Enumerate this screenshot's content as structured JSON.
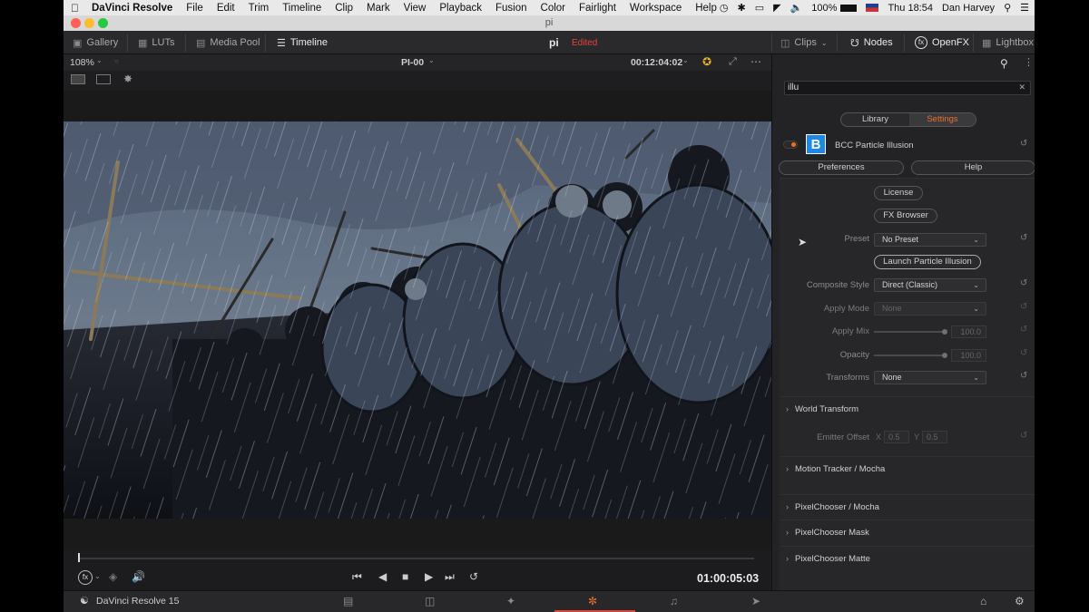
{
  "menubar": {
    "app_name": "DaVinci Resolve",
    "items": [
      "File",
      "Edit",
      "Trim",
      "Timeline",
      "Clip",
      "Mark",
      "View",
      "Playback",
      "Fusion",
      "Color",
      "Fairlight",
      "Workspace",
      "Help"
    ],
    "battery": "100%",
    "clock": "Thu 18:54",
    "user": "Dan Harvey"
  },
  "window": {
    "title": "pi"
  },
  "toolbar": {
    "gallery": "Gallery",
    "luts": "LUTs",
    "media_pool": "Media Pool",
    "timeline": "Timeline",
    "project_name": "pi",
    "project_status": "Edited",
    "clips": "Clips",
    "nodes": "Nodes",
    "openfx": "OpenFX",
    "lightbox": "Lightbox"
  },
  "viewer": {
    "zoom": "108%",
    "clip_name": "PI-00",
    "source_timecode": "00:12:04:02",
    "record_timecode": "01:00:05:03"
  },
  "openfx_panel": {
    "search_value": "illu",
    "tabs": {
      "library": "Library",
      "settings": "Settings"
    },
    "plugin_name": "BCC Particle Illusion",
    "plugin_badge": "B",
    "preferences": "Preferences",
    "help": "Help",
    "license": "License",
    "fx_browser": "FX Browser",
    "preset_label": "Preset",
    "preset_value": "No Preset",
    "launch": "Launch Particle Illusion",
    "composite_label": "Composite Style",
    "composite_value": "Direct (Classic)",
    "apply_mode_label": "Apply Mode",
    "apply_mode_value": "None",
    "apply_mix_label": "Apply Mix",
    "apply_mix_value": "100.0",
    "opacity_label": "Opacity",
    "opacity_value": "100.0",
    "transforms_label": "Transforms",
    "transforms_value": "None",
    "emitter_label": "Emitter Offset",
    "emitter_x_label": "X",
    "emitter_x": "0.5",
    "emitter_y_label": "Y",
    "emitter_y": "0.5",
    "sections": [
      "World Transform",
      "Motion Tracker / Mocha",
      "PixelChooser / Mocha",
      "PixelChooser Mask",
      "PixelChooser Matte"
    ]
  },
  "bottom": {
    "app_version": "DaVinci Resolve 15"
  },
  "colors": {
    "accent_orange": "#e8702a",
    "edited_red": "#e0443c",
    "bcc_blue": "#1e88e5"
  }
}
